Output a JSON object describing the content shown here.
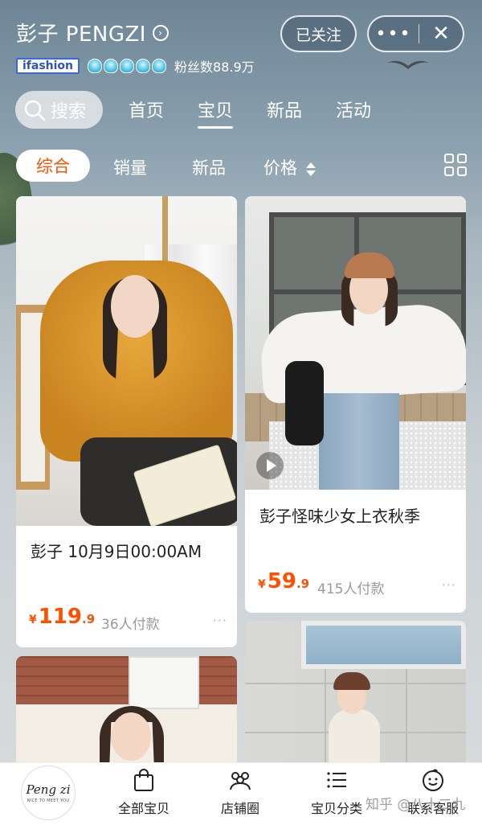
{
  "header": {
    "shop_name": "彭子 PENGZI",
    "badge": "ifashion",
    "fans": "粉丝数88.9万",
    "follow_label": "已关注",
    "more_label": "•••",
    "close_label": "✕"
  },
  "tabs": {
    "search_label": "搜索",
    "items": [
      "首页",
      "宝贝",
      "新品",
      "活动"
    ],
    "active": "宝贝"
  },
  "sort": {
    "items": [
      "综合",
      "销量",
      "新品",
      "价格"
    ],
    "active": "综合"
  },
  "products": [
    {
      "title": "彭子 10月9日00:00AM",
      "currency": "¥",
      "price_int": "119",
      "price_dec": ".9",
      "sold": "36人付款",
      "more": "···"
    },
    {
      "title": "彭子怪味少女上衣秋季",
      "currency": "¥",
      "price_int": "59",
      "price_dec": ".9",
      "sold": "415人付款",
      "more": "···"
    }
  ],
  "bottom_nav": {
    "logo_text": "Peng zi",
    "logo_sub": "NICE TO MEET YOU",
    "items": [
      "全部宝贝",
      "店铺圈",
      "宝贝分类",
      "联系客服"
    ]
  },
  "watermark": "知乎 @八十二九",
  "colors": {
    "accent": "#ff5000"
  }
}
